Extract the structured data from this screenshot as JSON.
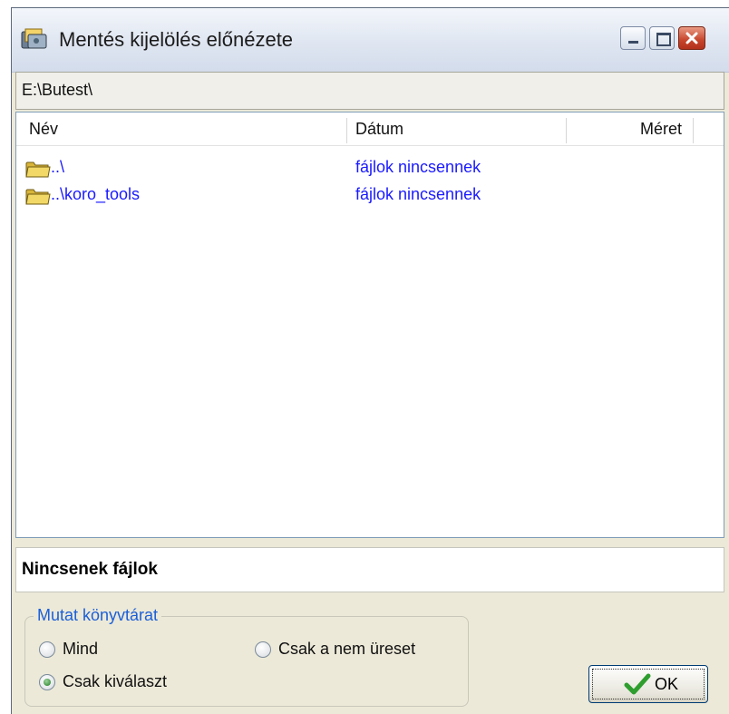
{
  "window": {
    "title": "Mentés kijelölés előnézete",
    "path": "E:\\Butest\\"
  },
  "icons": {
    "app": "app-icon",
    "minimize": "minimize-icon",
    "maximize": "maximize-icon",
    "close": "close-icon",
    "folder": "folder-icon",
    "ok": "checkmark-icon"
  },
  "list": {
    "columns": [
      "Név",
      "Dátum",
      "Méret"
    ],
    "rows": [
      {
        "name": "..\\",
        "date": "fájlok nincsennek"
      },
      {
        "name": "..\\koro_tools",
        "date": "fájlok nincsennek"
      }
    ]
  },
  "status": "Nincsenek fájlok",
  "group": {
    "legend": "Mutat könyvtárat",
    "options": [
      "Mind",
      "Csak a nem üreset",
      "Csak kiválaszt"
    ],
    "selected": "Csak kiválaszt"
  },
  "ok_label": "OK",
  "colors": {
    "link": "#1a1aff",
    "legend": "#1b5fd9",
    "close": "#c6452b",
    "checkmark": "#2e9e2e"
  }
}
